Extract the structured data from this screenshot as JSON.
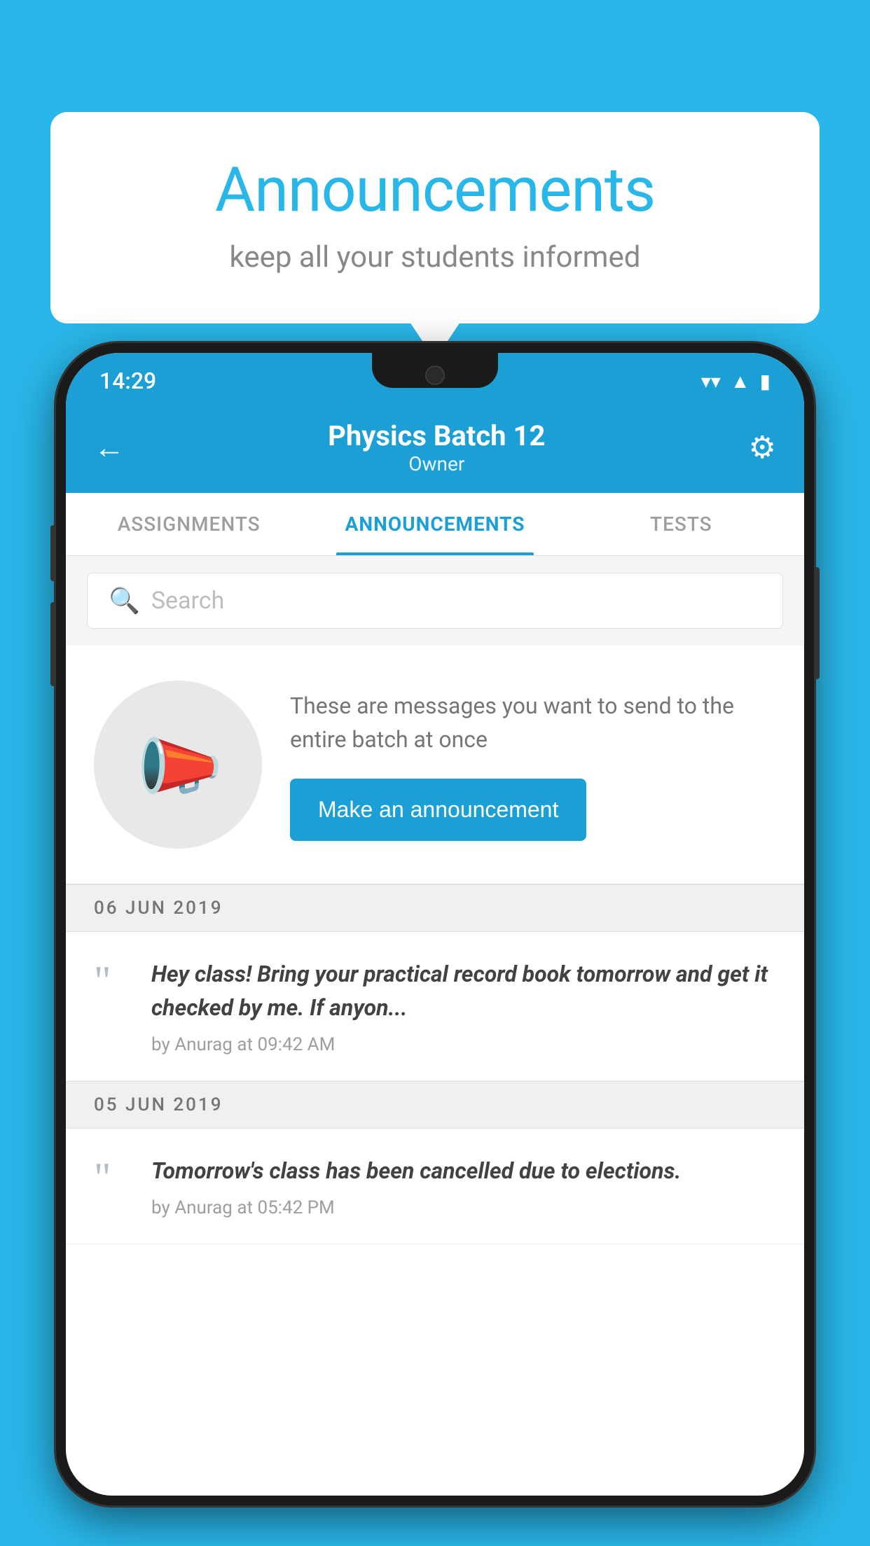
{
  "background_color": "#29b6e8",
  "speech_bubble": {
    "title": "Announcements",
    "subtitle": "keep all your students informed"
  },
  "status_bar": {
    "time": "14:29",
    "icons": [
      "wifi",
      "signal",
      "battery"
    ]
  },
  "app_header": {
    "title": "Physics Batch 12",
    "subtitle": "Owner",
    "back_label": "←",
    "gear_label": "⚙"
  },
  "tabs": [
    {
      "label": "ASSIGNMENTS",
      "active": false
    },
    {
      "label": "ANNOUNCEMENTS",
      "active": true
    },
    {
      "label": "TESTS",
      "active": false
    }
  ],
  "search": {
    "placeholder": "Search"
  },
  "promo": {
    "description": "These are messages you want to send to the entire batch at once",
    "button_label": "Make an announcement"
  },
  "date_groups": [
    {
      "date": "06  JUN  2019",
      "messages": [
        {
          "text": "Hey class! Bring your practical record book tomorrow and get it checked by me. If anyon...",
          "meta": "by Anurag at 09:42 AM"
        }
      ]
    },
    {
      "date": "05  JUN  2019",
      "messages": [
        {
          "text": "Tomorrow's class has been cancelled due to elections.",
          "meta": "by Anurag at 05:42 PM"
        }
      ]
    }
  ]
}
